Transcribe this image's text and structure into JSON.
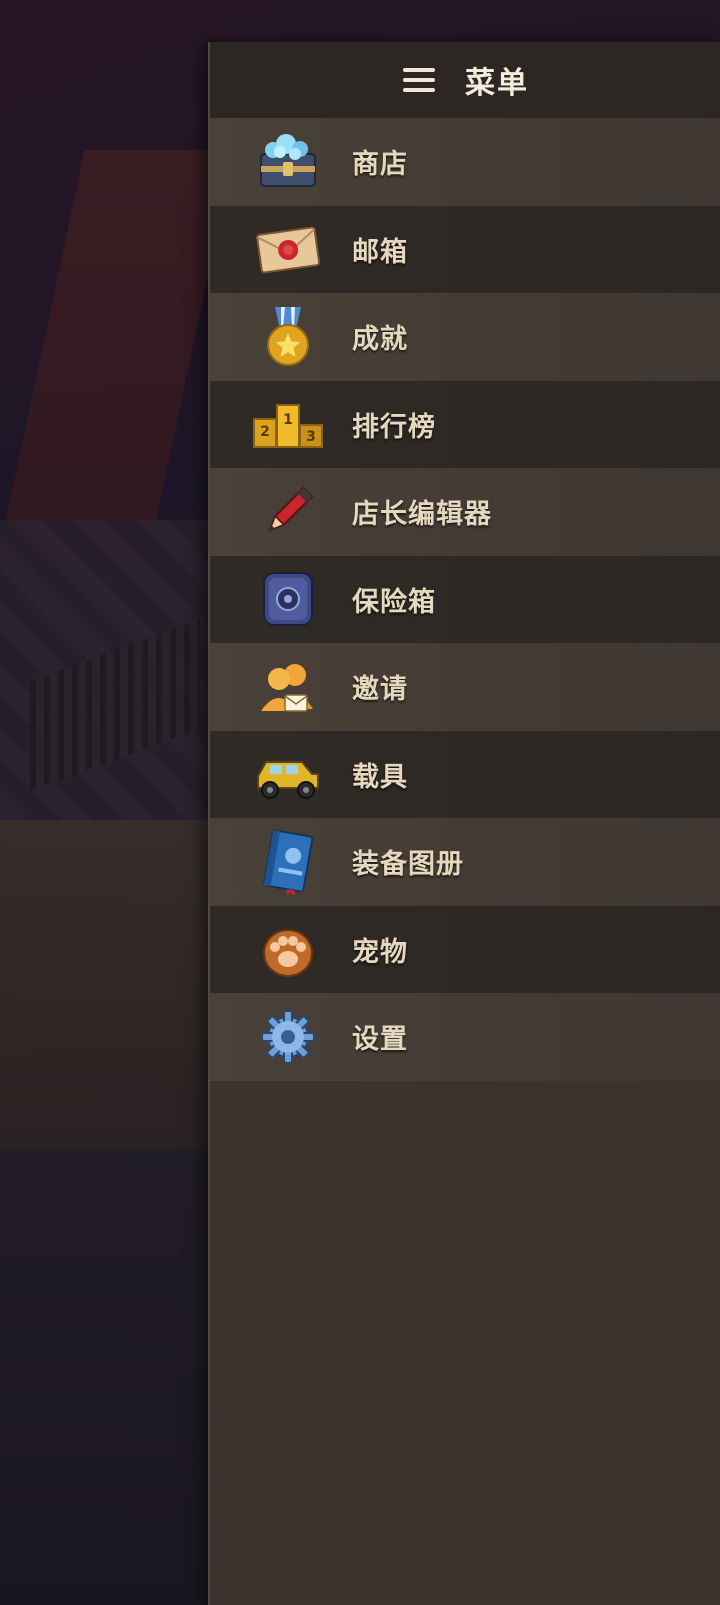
{
  "menu": {
    "title": "菜单",
    "items": [
      {
        "label": "商店",
        "icon": "gem-chest-icon"
      },
      {
        "label": "邮箱",
        "icon": "sealed-letter-icon"
      },
      {
        "label": "成就",
        "icon": "medal-icon"
      },
      {
        "label": "排行榜",
        "icon": "podium-icon"
      },
      {
        "label": "店长编辑器",
        "icon": "pencil-icon"
      },
      {
        "label": "保险箱",
        "icon": "safe-icon"
      },
      {
        "label": "邀请",
        "icon": "invite-friends-icon"
      },
      {
        "label": "载具",
        "icon": "jeep-icon"
      },
      {
        "label": "装备图册",
        "icon": "book-icon"
      },
      {
        "label": "宠物",
        "icon": "paw-icon"
      },
      {
        "label": "设置",
        "icon": "gear-icon"
      }
    ]
  },
  "colors": {
    "panel_bg": "#3a342f",
    "header_bg": "#2c2723",
    "label_text": "#e6d8be",
    "title_text": "#f4ecdd"
  }
}
